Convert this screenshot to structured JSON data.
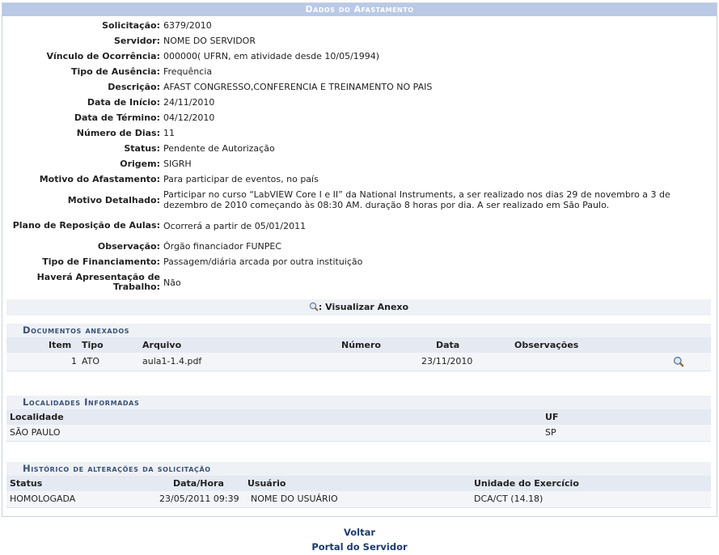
{
  "caption": "Dados do Afastamento",
  "fields": [
    {
      "label": "Solicitação:",
      "value": "6379/2010"
    },
    {
      "label": "Servidor:",
      "value": "NOME DO SERVIDOR"
    },
    {
      "label": "Vínculo de Ocorrência:",
      "value": "000000( UFRN, em atividade desde 10/05/1994)"
    },
    {
      "label": "Tipo de Ausência:",
      "value": "Frequência"
    },
    {
      "label": "Descrição:",
      "value": "AFAST CONGRESSO,CONFERENCIA E TREINAMENTO NO PAIS"
    },
    {
      "label": "Data de Início:",
      "value": "24/11/2010"
    },
    {
      "label": "Data de Término:",
      "value": "04/12/2010"
    },
    {
      "label": "Número de Dias:",
      "value": "11"
    },
    {
      "label": "Status:",
      "value": "Pendente de Autorização"
    },
    {
      "label": "Origem:",
      "value": "SIGRH"
    },
    {
      "label": "Motivo do Afastamento:",
      "value": "Para participar de eventos, no país"
    },
    {
      "label": "Motivo Detalhado:",
      "value": "Participar no curso “LabVIEW Core I e II” da National Instruments, a ser realizado nos dias 29 de novembro a 3 de dezembro de 2010 começando às 08:30 AM. duração 8 horas por dia. A ser realizado em São Paulo."
    },
    {
      "label": "Plano de Reposição de Aulas:",
      "value": "Ocorrerá a partir de 05/01/2011"
    },
    {
      "label": "Observação:",
      "value": "Órgão financiador FUNPEC"
    },
    {
      "label": "Tipo de Financiamento:",
      "value": "Passagem/diária arcada por outra instituição"
    },
    {
      "label": "Haverá Apresentação de Trabalho:",
      "value": "Não"
    }
  ],
  "anexo_link": ": Visualizar Anexo",
  "documentos": {
    "title": "Documentos anexados",
    "headers": {
      "item": "Item",
      "tipo": "Tipo",
      "arquivo": "Arquivo",
      "numero": "Número",
      "data": "Data",
      "observacoes": "Observações"
    },
    "rows": [
      {
        "item": "1",
        "tipo": "ATO",
        "arquivo": "aula1-1.4.pdf",
        "numero": "",
        "data": "23/11/2010",
        "observacoes": ""
      }
    ]
  },
  "localidades": {
    "title": "Localidades Informadas",
    "headers": {
      "localidade": "Localidade",
      "uf": "UF"
    },
    "rows": [
      {
        "localidade": "SÃO PAULO",
        "uf": "SP"
      }
    ]
  },
  "historico": {
    "title": "Histórico de alterações da solicitação",
    "headers": {
      "status": "Status",
      "datahora": "Data/Hora",
      "usuario": "Usuário",
      "unidade": "Unidade do Exercício"
    },
    "rows": [
      {
        "status": "HOMOLOGADA",
        "datahora": "23/05/2011 09:39",
        "usuario": "NOME DO USUÁRIO",
        "unidade": "DCA/CT (14.18)"
      }
    ]
  },
  "links": {
    "voltar": "Voltar",
    "portal": "Portal do Servidor"
  },
  "icons": {
    "view": "magnifier-icon"
  },
  "colors": {
    "caption_bg": "#b9c9e6",
    "section_title": "#3b5177",
    "link": "#1f3a6d"
  }
}
